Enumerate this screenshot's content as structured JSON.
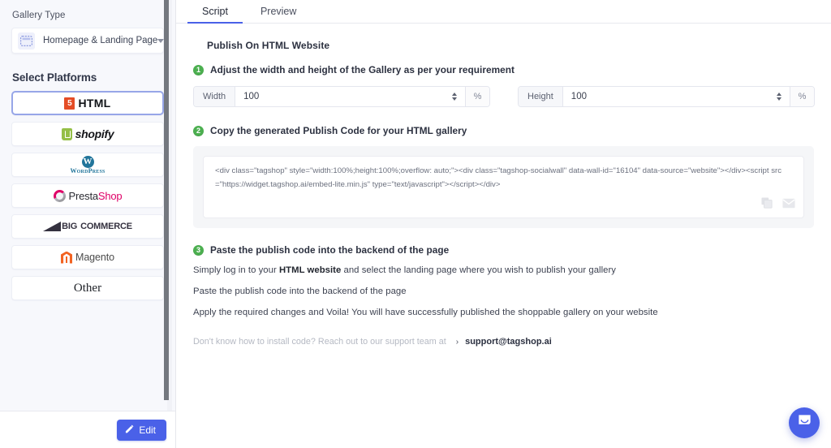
{
  "sidebar": {
    "gallery_type_label": "Gallery Type",
    "gallery_type_value": "Homepage & Landing Page",
    "select_platforms_label": "Select Platforms",
    "platforms": [
      {
        "id": "html",
        "label": "HTML",
        "selected": true
      },
      {
        "id": "shopify",
        "label": "shopify",
        "selected": false
      },
      {
        "id": "wordpress",
        "label": "WordPress",
        "selected": false
      },
      {
        "id": "prestashop",
        "label": "PrestaShop",
        "selected": false
      },
      {
        "id": "bigcommerce",
        "label": "COMMERCE",
        "selected": false
      },
      {
        "id": "magento",
        "label": "Magento",
        "selected": false
      },
      {
        "id": "other",
        "label": "Other",
        "selected": false
      }
    ],
    "bigcommerce_prefix": "BIG",
    "presta_part1": "Presta",
    "presta_part2": "Shop",
    "html5_badge": "5",
    "wp_mark": "W",
    "edit_button": "Edit"
  },
  "tabs": [
    {
      "id": "script",
      "label": "Script",
      "active": true
    },
    {
      "id": "preview",
      "label": "Preview",
      "active": false
    }
  ],
  "main": {
    "publish_title": "Publish On HTML Website",
    "step1": {
      "number": "1",
      "text": "Adjust the width and height of the Gallery as per your requirement",
      "width_label": "Width",
      "width_value": "100",
      "width_unit": "%",
      "height_label": "Height",
      "height_value": "100",
      "height_unit": "%"
    },
    "step2": {
      "number": "2",
      "text": "Copy the generated Publish Code for your HTML gallery",
      "code": "<div class=\"tagshop\" style=\"width:100%;height:100%;overflow: auto;\"><div class=\"tagshop-socialwall\" data-wall-id=\"16104\" data-source=\"website\"></div><script src=\"https://widget.tagshop.ai/embed-lite.min.js\" type=\"text/javascript\"></script></div>"
    },
    "step3": {
      "number": "3",
      "text": "Paste the publish code into the backend of the page",
      "lines": [
        {
          "pre": "Simply log in to your ",
          "bold": "HTML website",
          "post": " and select the landing page where you wish to publish your gallery"
        },
        {
          "pre": "Paste the publish code into the backend of the page",
          "bold": "",
          "post": ""
        },
        {
          "pre": "Apply the required changes and Voila! You will have successfully published the shoppable gallery on your website",
          "bold": "",
          "post": ""
        }
      ]
    },
    "support": {
      "question": "Don't know how to install code? Reach out to our support team at",
      "chevron": "›",
      "email": "support@tagshop.ai"
    }
  },
  "colors": {
    "accent": "#4a61e8",
    "step_badge": "#4caf50",
    "sidebar_bg": "#f7f8fc",
    "selected_border": "#97a6e8"
  }
}
